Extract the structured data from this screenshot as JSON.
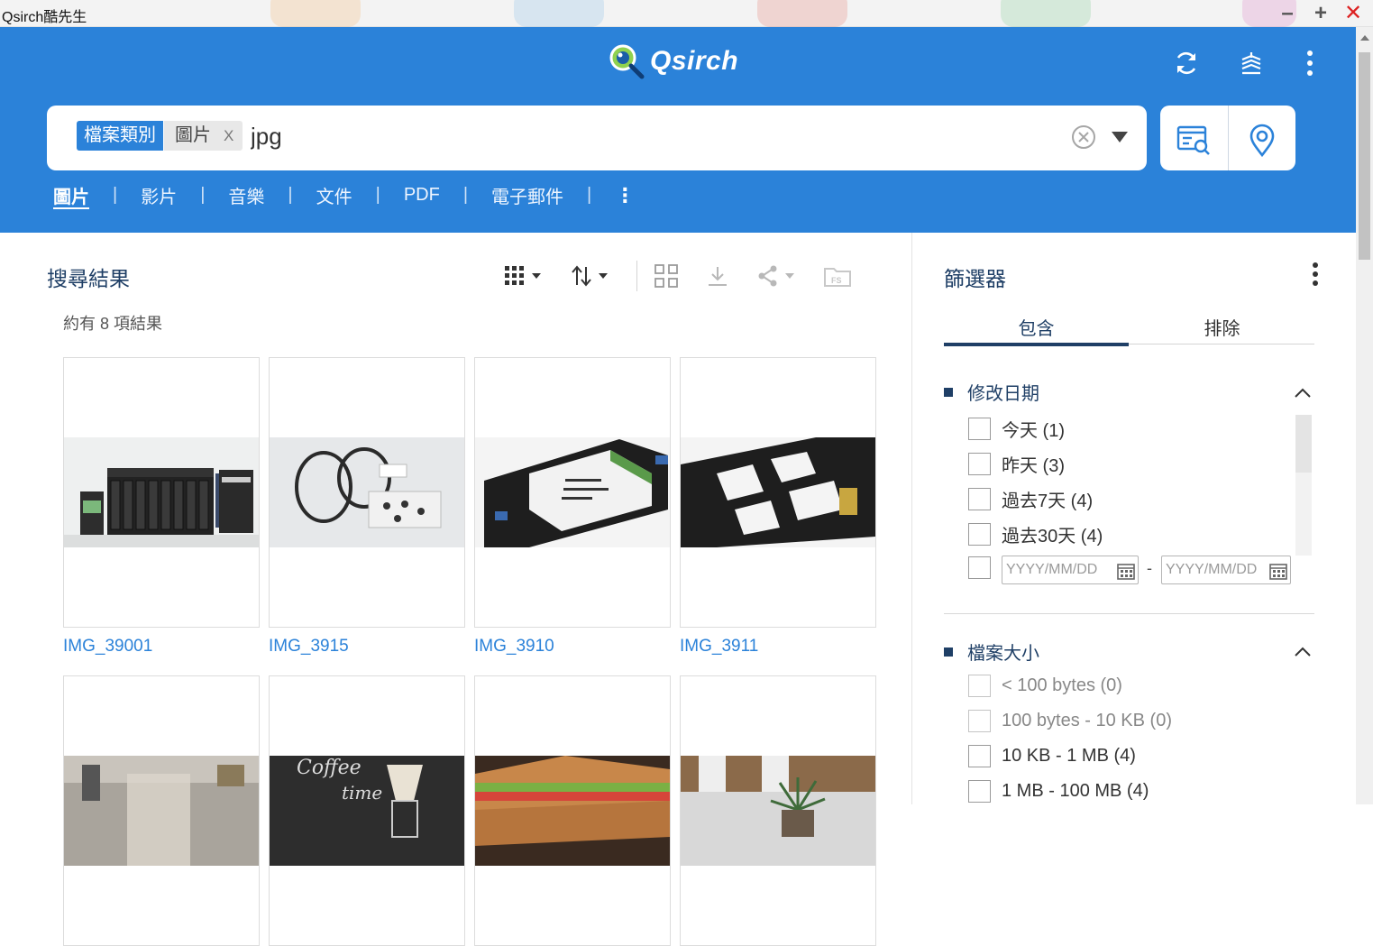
{
  "window": {
    "title": "Qsirch酷先生"
  },
  "header": {
    "logo_text": "Qsirch",
    "search": {
      "filter_category": "檔案類別",
      "filter_value": "圖片",
      "filter_remove": "X",
      "query": "jpg",
      "placeholder": ""
    },
    "tabs": [
      "圖片",
      "影片",
      "音樂",
      "文件",
      "PDF",
      "電子郵件"
    ],
    "tabs_more": "⋮",
    "active_tab": "圖片"
  },
  "results": {
    "title": "搜尋結果",
    "count_text": "約有 8 項結果",
    "items": [
      {
        "name": "IMG_39001",
        "scene": "nas-device"
      },
      {
        "name": "IMG_3915",
        "scene": "cables-and-screws"
      },
      {
        "name": "IMG_3910",
        "scene": "drive-in-tray"
      },
      {
        "name": "IMG_3911",
        "scene": "drive-tray"
      },
      {
        "name": "",
        "scene": "cafe-glass"
      },
      {
        "name": "",
        "scene": "coffee-chalkboard"
      },
      {
        "name": "",
        "scene": "sandwich"
      },
      {
        "name": "",
        "scene": "plant-window"
      }
    ]
  },
  "filter": {
    "title": "篩選器",
    "tabs": {
      "include": "包含",
      "exclude": "排除"
    },
    "modified": {
      "title": "修改日期",
      "options": [
        "今天 (1)",
        "昨天 (3)",
        "過去7天 (4)",
        "過去30天 (4)"
      ],
      "date_from_placeholder": "YYYY/MM/DD",
      "date_to_placeholder": "YYYY/MM/DD",
      "date_sep": "-"
    },
    "size": {
      "title": "檔案大小",
      "options": [
        "< 100 bytes (0)",
        "100 bytes - 10 KB (0)",
        "10 KB - 1 MB (4)",
        "1 MB - 100 MB (4)"
      ]
    }
  },
  "colors": {
    "brand": "#2b82d9",
    "navy": "#1f3f66",
    "link": "#2b82d9"
  }
}
